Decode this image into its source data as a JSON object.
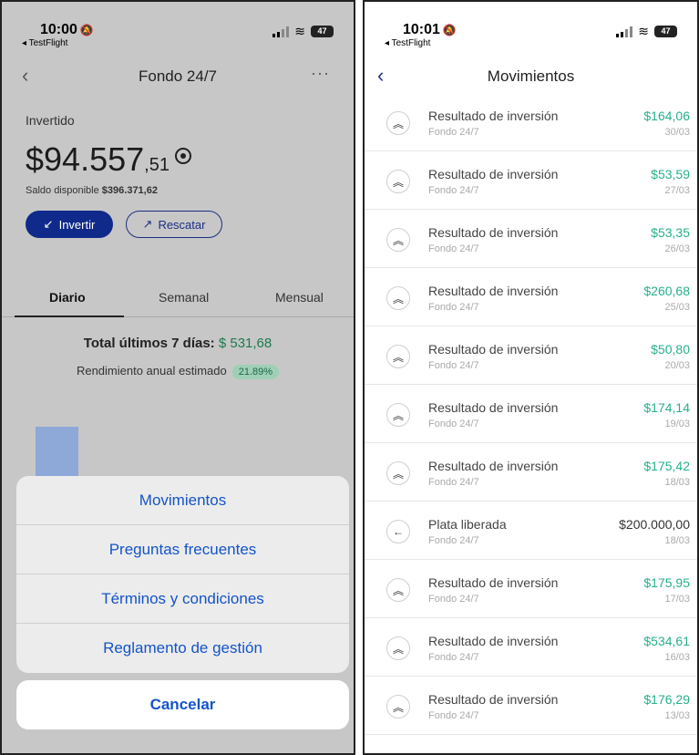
{
  "left": {
    "status": {
      "time": "10:00",
      "back_app": "◂ TestFlight",
      "battery": "47"
    },
    "header": {
      "title": "Fondo 24/7"
    },
    "invested_label": "Invertido",
    "amount": {
      "currency": "$",
      "main": "94.557",
      "cents": ",51"
    },
    "saldo": {
      "label": "Saldo disponible",
      "value": "$396.371,62"
    },
    "buttons": {
      "invertir": "Invertir",
      "rescatar": "Rescatar"
    },
    "tabs": [
      "Diario",
      "Semanal",
      "Mensual"
    ],
    "total": {
      "label": "Total últimos 7 días:",
      "value": "$ 531,68"
    },
    "rendimiento": {
      "label": "Rendimiento anual estimado",
      "value": "21.89%"
    },
    "sheet": {
      "items": [
        "Movimientos",
        "Preguntas frecuentes",
        "Términos y condiciones",
        "Reglamento de gestión"
      ],
      "cancel": "Cancelar"
    }
  },
  "right": {
    "status": {
      "time": "10:01",
      "back_app": "◂ TestFlight",
      "battery": "47"
    },
    "header": {
      "title": "Movimientos"
    },
    "rows": [
      {
        "icon": "double-chevron-up-icon",
        "title": "Resultado de inversión",
        "subtitle": "Fondo 24/7",
        "amount": "$164,06",
        "date": "30/03",
        "positive": true
      },
      {
        "icon": "double-chevron-up-icon",
        "title": "Resultado de inversión",
        "subtitle": "Fondo 24/7",
        "amount": "$53,59",
        "date": "27/03",
        "positive": true
      },
      {
        "icon": "double-chevron-up-icon",
        "title": "Resultado de inversión",
        "subtitle": "Fondo 24/7",
        "amount": "$53,35",
        "date": "26/03",
        "positive": true
      },
      {
        "icon": "double-chevron-up-icon",
        "title": "Resultado de inversión",
        "subtitle": "Fondo 24/7",
        "amount": "$260,68",
        "date": "25/03",
        "positive": true
      },
      {
        "icon": "double-chevron-up-icon",
        "title": "Resultado de inversión",
        "subtitle": "Fondo 24/7",
        "amount": "$50,80",
        "date": "20/03",
        "positive": true
      },
      {
        "icon": "double-chevron-up-icon",
        "title": "Resultado de inversión",
        "subtitle": "Fondo 24/7",
        "amount": "$174,14",
        "date": "19/03",
        "positive": true
      },
      {
        "icon": "double-chevron-up-icon",
        "title": "Resultado de inversión",
        "subtitle": "Fondo 24/7",
        "amount": "$175,42",
        "date": "18/03",
        "positive": true
      },
      {
        "icon": "arrow-left-icon",
        "title": "Plata liberada",
        "subtitle": "Fondo 24/7",
        "amount": "$200.000,00",
        "date": "18/03",
        "positive": false
      },
      {
        "icon": "double-chevron-up-icon",
        "title": "Resultado de inversión",
        "subtitle": "Fondo 24/7",
        "amount": "$175,95",
        "date": "17/03",
        "positive": true
      },
      {
        "icon": "double-chevron-up-icon",
        "title": "Resultado de inversión",
        "subtitle": "Fondo 24/7",
        "amount": "$534,61",
        "date": "16/03",
        "positive": true
      },
      {
        "icon": "double-chevron-up-icon",
        "title": "Resultado de inversión",
        "subtitle": "Fondo 24/7",
        "amount": "$176,29",
        "date": "13/03",
        "positive": true
      }
    ]
  },
  "colors": {
    "brand": "#0f2a8a",
    "positive": "#25b08a",
    "link": "#1454c8"
  }
}
